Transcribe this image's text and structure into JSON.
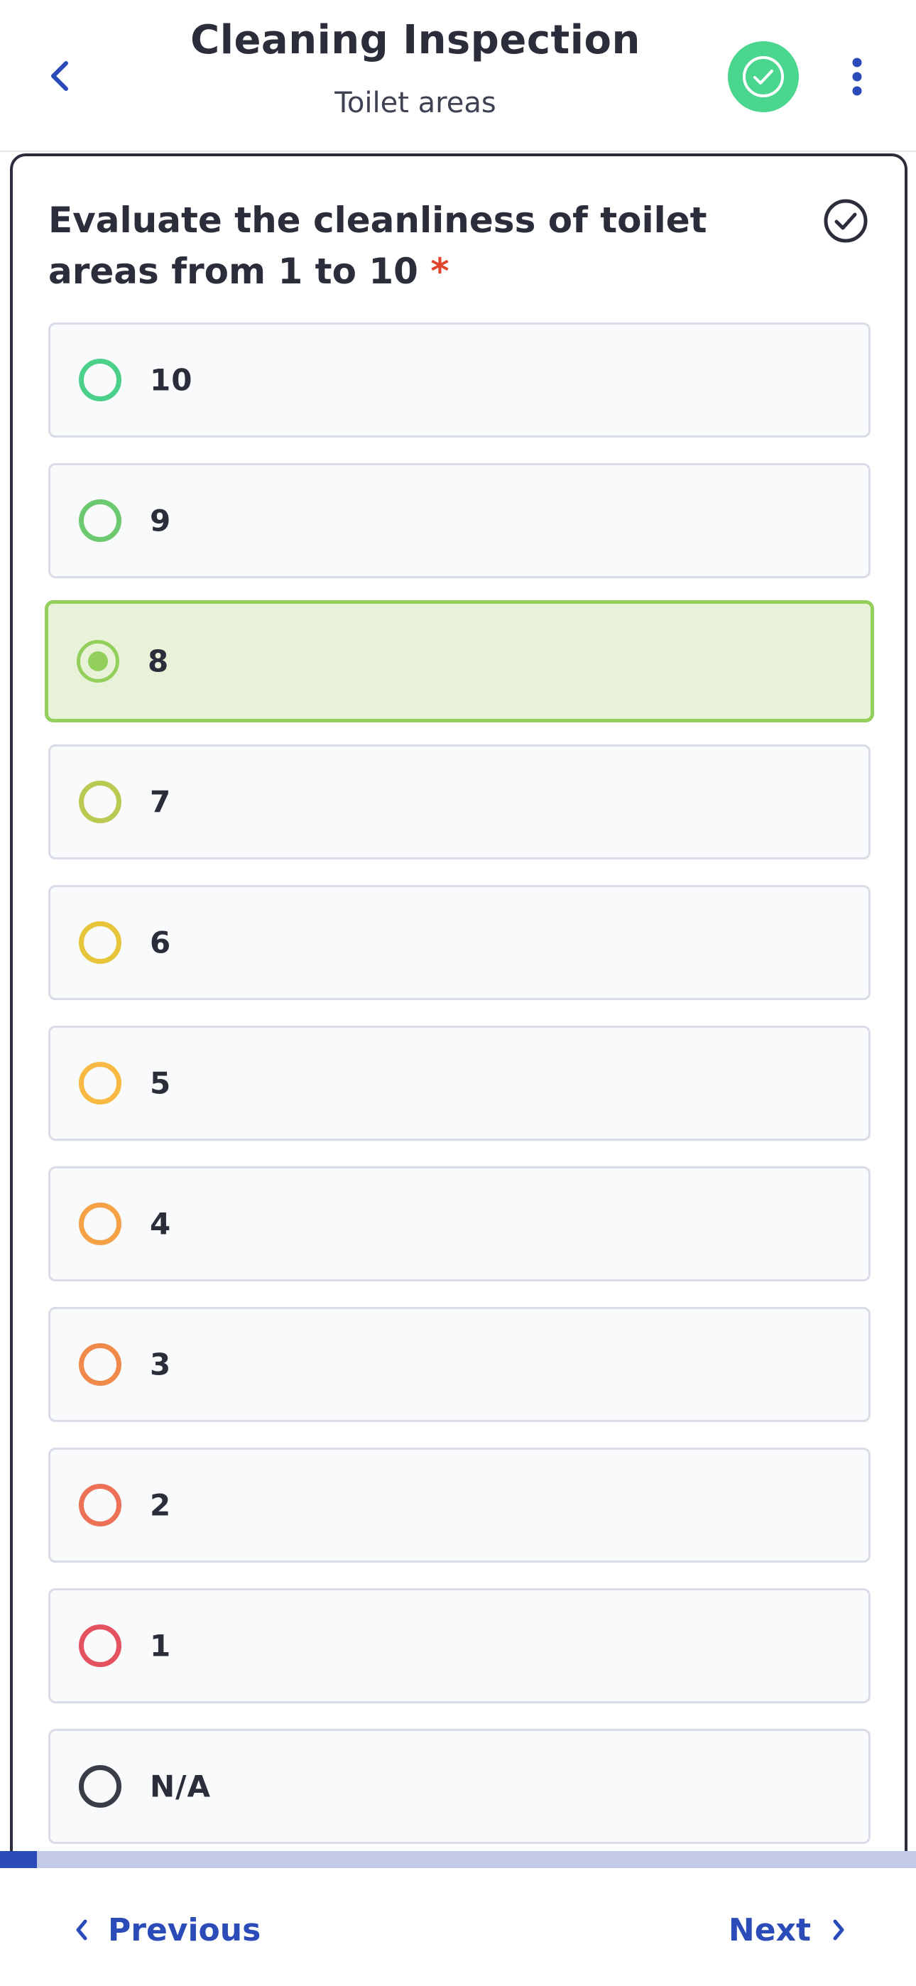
{
  "header": {
    "title": "Cleaning Inspection",
    "subtitle": "Toilet areas",
    "status_color": "#4bd68f"
  },
  "question": {
    "text": "Evaluate the cleanliness of toilet areas from 1 to 10",
    "required_mark": "*"
  },
  "options": [
    {
      "label": "10",
      "color": "#4bd08a",
      "selected": false
    },
    {
      "label": "9",
      "color": "#6cc96f",
      "selected": false
    },
    {
      "label": "8",
      "color": "#93cf5b",
      "selected": true
    },
    {
      "label": "7",
      "color": "#bac952",
      "selected": false
    },
    {
      "label": "6",
      "color": "#e6c53a",
      "selected": false
    },
    {
      "label": "5",
      "color": "#f7b941",
      "selected": false
    },
    {
      "label": "4",
      "color": "#f5a246",
      "selected": false
    },
    {
      "label": "3",
      "color": "#f08a4b",
      "selected": false
    },
    {
      "label": "2",
      "color": "#ec7157",
      "selected": false
    },
    {
      "label": "1",
      "color": "#e4515f",
      "selected": false
    },
    {
      "label": "N/A",
      "color": "#3a3d48",
      "selected": false
    }
  ],
  "progress": {
    "fraction": 0.04,
    "fill_color": "#2b4bb8",
    "track_color": "#c4cbe9"
  },
  "footer": {
    "previous_label": "Previous",
    "next_label": "Next"
  }
}
